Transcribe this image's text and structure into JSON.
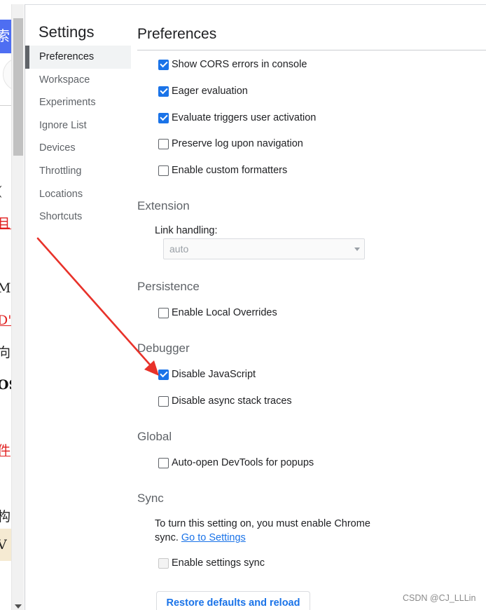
{
  "background_page": {
    "search_fragment": "索",
    "fragments": [
      {
        "text": "(",
        "style": "dark"
      },
      {
        "text": "且:",
        "style": "red"
      },
      {
        "text": "MO",
        "style": "dark"
      },
      {
        "text": "D\"",
        "style": "red"
      },
      {
        "text": "向",
        "style": "dark"
      },
      {
        "text": "OS",
        "style": "bold"
      },
      {
        "text": "件",
        "style": "red"
      },
      {
        "text": "构",
        "style": "dark"
      },
      {
        "text": "V",
        "style": "dark"
      }
    ]
  },
  "settings": {
    "title": "Settings",
    "nav": [
      {
        "label": "Preferences",
        "selected": true
      },
      {
        "label": "Workspace",
        "selected": false
      },
      {
        "label": "Experiments",
        "selected": false
      },
      {
        "label": "Ignore List",
        "selected": false
      },
      {
        "label": "Devices",
        "selected": false
      },
      {
        "label": "Throttling",
        "selected": false
      },
      {
        "label": "Locations",
        "selected": false
      },
      {
        "label": "Shortcuts",
        "selected": false
      }
    ]
  },
  "preferences": {
    "title": "Preferences",
    "console_options": [
      {
        "label": "Show CORS errors in console",
        "checked": true
      },
      {
        "label": "Eager evaluation",
        "checked": true
      },
      {
        "label": "Evaluate triggers user activation",
        "checked": true
      },
      {
        "label": "Preserve log upon navigation",
        "checked": false
      },
      {
        "label": "Enable custom formatters",
        "checked": false
      }
    ],
    "extension": {
      "heading": "Extension",
      "link_handling_label": "Link handling:",
      "link_handling_value": "auto"
    },
    "persistence": {
      "heading": "Persistence",
      "option": {
        "label": "Enable Local Overrides",
        "checked": false
      }
    },
    "debugger": {
      "heading": "Debugger",
      "options": [
        {
          "label": "Disable JavaScript",
          "checked": true
        },
        {
          "label": "Disable async stack traces",
          "checked": false
        }
      ]
    },
    "global": {
      "heading": "Global",
      "option": {
        "label": "Auto-open DevTools for popups",
        "checked": false
      }
    },
    "sync": {
      "heading": "Sync",
      "message": "To turn this setting on, you must enable Chrome sync.",
      "link": "Go to Settings",
      "option": {
        "label": "Enable settings sync",
        "checked": false,
        "disabled": true
      }
    },
    "restore_button": "Restore defaults and reload"
  },
  "annotation": {
    "arrow_color": "#e8322a"
  },
  "watermark": "CSDN @CJ_LLLin",
  "colors": {
    "accent": "#1a73e8",
    "text": "#202124",
    "muted": "#5f6368"
  }
}
